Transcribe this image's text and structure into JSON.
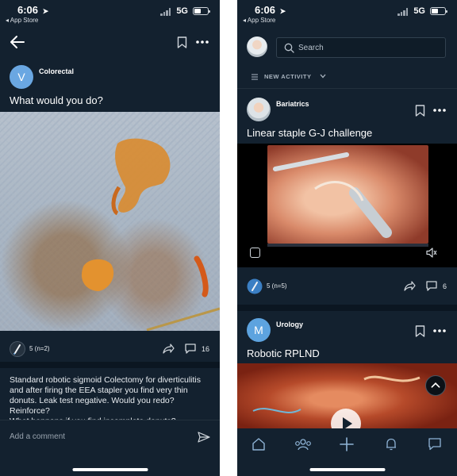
{
  "left": {
    "status": {
      "time": "6:06",
      "network": "5G",
      "back_app": "◂ App Store",
      "battery": 0.45
    },
    "post": {
      "avatar_letter": "V",
      "community": "Colorectal",
      "title": "What would you do?",
      "votes": "5 (n=2)",
      "comments": "16",
      "description": [
        "Standard robotic sigmoid Colectomy for diverticulitis and after firing the EEA stapler you find very thin donuts. Leak test negative. Would you redo? Reinforce?",
        "What happens if you find incomplete donuts?"
      ]
    },
    "comment_placeholder": "Add a comment"
  },
  "right": {
    "status": {
      "time": "6:06",
      "network": "5G",
      "back_app": "◂ App Store",
      "battery": 0.45
    },
    "search_placeholder": "Search",
    "filter_label": "NEW ACTIVITY",
    "posts": [
      {
        "community": "Bariatrics",
        "title": "Linear staple G-J challenge",
        "votes": "5 (n=5)",
        "comments": "6"
      },
      {
        "avatar_letter": "M",
        "community": "Urology",
        "title": "Robotic RPLND"
      }
    ]
  },
  "colors": {
    "background": "#13212f",
    "accent": "#6aa7e2",
    "divider": "#0b1621"
  },
  "icons": [
    "back-arrow-icon",
    "bookmark-icon",
    "more-icon",
    "vote-icon",
    "share-icon",
    "comment-icon",
    "send-icon",
    "search-icon",
    "filter-icon",
    "chevron-down-icon",
    "home-icon",
    "people-icon",
    "plus-icon",
    "bell-icon",
    "chat-icon",
    "chevron-up-icon",
    "play-icon",
    "mute-icon",
    "fullscreen-icon"
  ]
}
